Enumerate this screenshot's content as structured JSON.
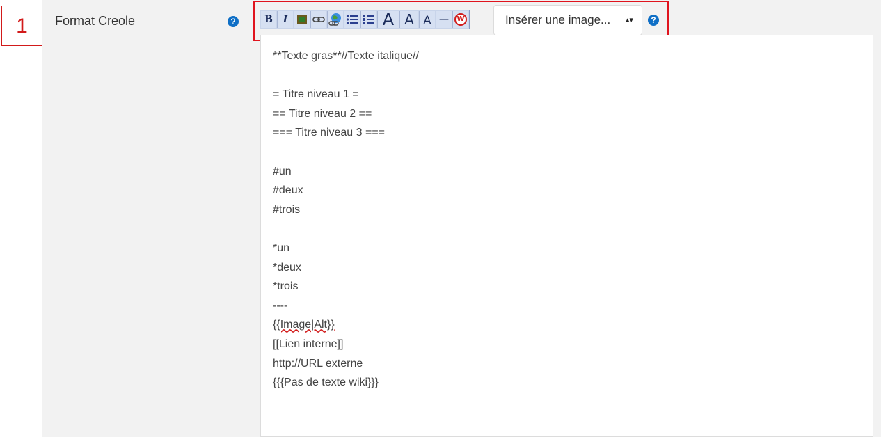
{
  "marker": {
    "number": "1"
  },
  "field": {
    "label": "Format Creole",
    "help_glyph": "?"
  },
  "toolbar": {
    "bold": "B",
    "italic": "I",
    "image_icon": "image-icon",
    "link_icon": "link-icon",
    "external_link_icon": "globe-link-icon",
    "unordered_list_icon": "bullet-list-icon",
    "ordered_list_icon": "numbered-list-icon",
    "heading1": "A",
    "heading2": "A",
    "heading3": "A",
    "hr": "—",
    "nowiki_icon": "nowiki-icon",
    "nowiki_glyph": "W",
    "highlight_color": "#e0141e"
  },
  "insert_image": {
    "value": "Insérer une image...",
    "caret": "▴▾"
  },
  "editor": {
    "lines": [
      "**Texte gras**//Texte italique//",
      "",
      "= Titre niveau 1 =",
      "== Titre niveau 2 ==",
      "=== Titre niveau 3 ===",
      "",
      "#un",
      "#deux",
      "#trois",
      "",
      "*un",
      "*deux",
      "*trois",
      "----",
      "{{Image|Alt}}",
      "[[Lien interne]]",
      "http://URL externe",
      "{{{Pas de texte wiki}}}"
    ]
  }
}
